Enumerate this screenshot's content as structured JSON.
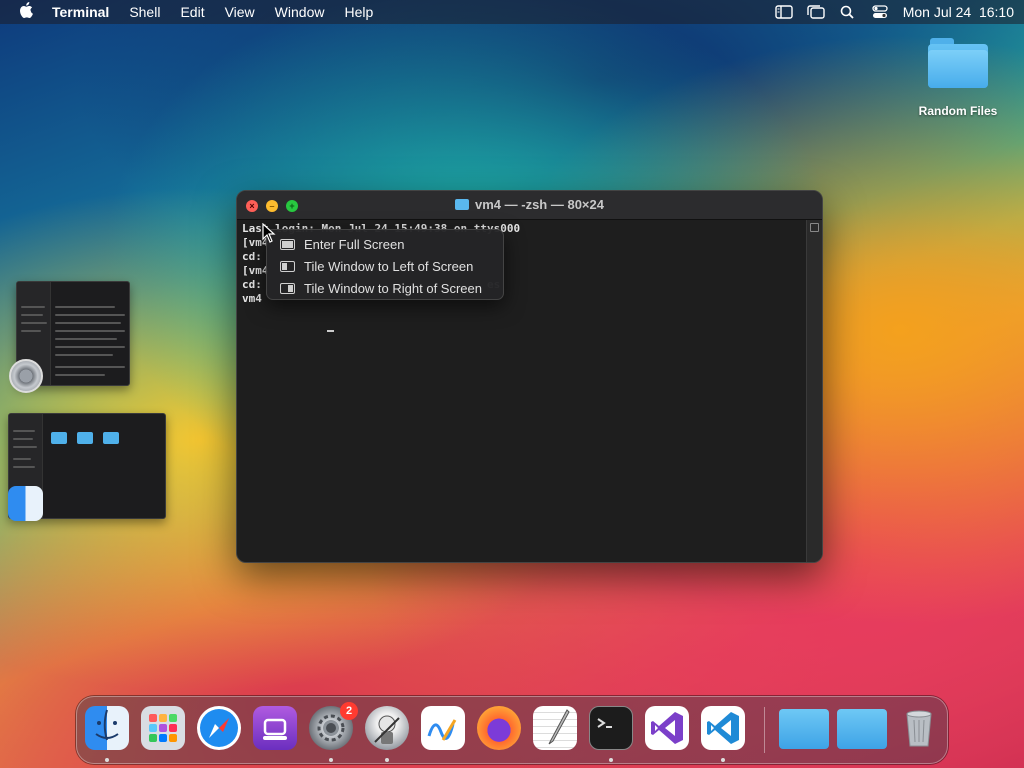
{
  "menubar": {
    "app_name": "Terminal",
    "items": [
      "Shell",
      "Edit",
      "View",
      "Window",
      "Help"
    ],
    "clock": "Mon Jul 24  16:10"
  },
  "desktop": {
    "folder_label": "Random Files"
  },
  "terminal": {
    "title": "vm4 — -zsh — 80×24",
    "lines": [
      "Last login: Mon Jul 24 15:49:38 on ttys000",
      "[vm4",
      "cd:",
      "[vm4",
      "cd:                                  es",
      "vm4"
    ]
  },
  "window_menu": {
    "items": [
      "Enter Full Screen",
      "Tile Window to Left of Screen",
      "Tile Window to Right of Screen"
    ]
  },
  "dock": {
    "items": [
      {
        "name": "Finder",
        "running": true
      },
      {
        "name": "Launchpad",
        "running": false
      },
      {
        "name": "Safari",
        "running": false
      },
      {
        "name": "Podcasts",
        "running": false
      },
      {
        "name": "System Settings",
        "running": true,
        "badge": "2"
      },
      {
        "name": "Automator",
        "running": true
      },
      {
        "name": "Freeform",
        "running": false
      },
      {
        "name": "Firefox",
        "running": false
      },
      {
        "name": "TextEdit",
        "running": false
      },
      {
        "name": "Terminal",
        "running": true
      },
      {
        "name": "Visual Studio",
        "running": false
      },
      {
        "name": "Visual Studio Code",
        "running": true
      },
      {
        "name": "Folder",
        "running": false
      },
      {
        "name": "Folder",
        "running": false
      },
      {
        "name": "Trash",
        "running": false
      }
    ]
  },
  "colors": {
    "accent": "#2f8cf0",
    "badge": "#ff3b30"
  }
}
